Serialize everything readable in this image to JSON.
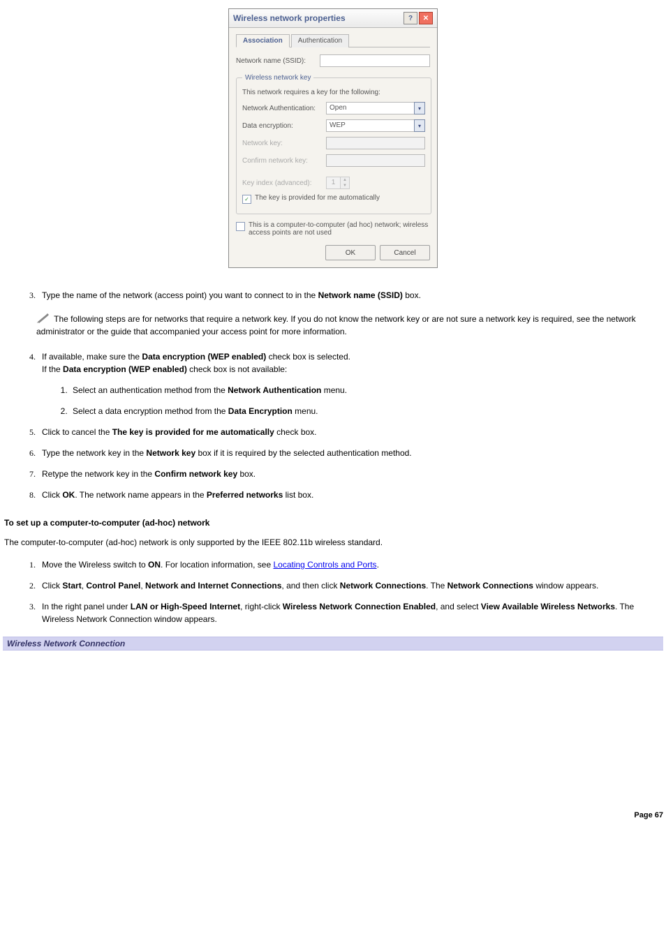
{
  "dialog": {
    "title": "Wireless network properties",
    "tabs": [
      "Association",
      "Authentication"
    ],
    "ssid_label": "Network name (SSID):",
    "group_legend": "Wireless network key",
    "group_note": "This network requires a key for the following:",
    "auth_label": "Network Authentication:",
    "auth_value": "Open",
    "enc_label": "Data encryption:",
    "enc_value": "WEP",
    "key_label": "Network key:",
    "confirm_label": "Confirm network key:",
    "keyindex_label": "Key index (advanced):",
    "keyindex_value": "1",
    "autokey_label": "The key is provided for me automatically",
    "adhoc_label": "This is a computer-to-computer (ad hoc) network; wireless access points are not used",
    "ok": "OK",
    "cancel": "Cancel"
  },
  "steps": {
    "s3_a": "Type the name of the network (access point) you want to connect to in the ",
    "s3_bold": "Network name (SSID)",
    "s3_b": " box.",
    "note": "The following steps are for networks that require a network key. If you do not know the network key or are not sure a network key is required, see the network administrator or the guide that accompanied your access point for more information.",
    "s4_a": "If available, make sure the ",
    "s4_bold1": "Data encryption (WEP enabled)",
    "s4_b": " check box is selected.",
    "s4_line2a": "If the ",
    "s4_line2bold": "Data encryption (WEP enabled)",
    "s4_line2b": " check box is not available:",
    "s4_1_a": "Select an authentication method from the ",
    "s4_1_bold": "Network Authentication",
    "s4_1_b": " menu.",
    "s4_2_a": "Select a data encryption method from the ",
    "s4_2_bold": "Data Encryption",
    "s4_2_b": " menu.",
    "s5_a": "Click to cancel the ",
    "s5_bold": "The key is provided for me automatically",
    "s5_b": " check box.",
    "s6_a": "Type the network key in the ",
    "s6_bold": "Network key",
    "s6_b": " box if it is required by the selected authentication method.",
    "s7_a": "Retype the network key in the ",
    "s7_bold": "Confirm network key",
    "s7_b": " box.",
    "s8_a": "Click ",
    "s8_bold1": "OK",
    "s8_b": ". The network name appears in the ",
    "s8_bold2": "Preferred networks",
    "s8_c": " list box."
  },
  "adhoc": {
    "heading": "To set up a computer-to-computer (ad-hoc) network",
    "intro": "The computer-to-computer (ad-hoc) network is only supported by the IEEE 802.11b wireless standard.",
    "s1_a": "Move the Wireless switch to ",
    "s1_bold": "ON",
    "s1_b": ". For location information, see ",
    "s1_link": "Locating Controls and Ports",
    "s1_c": ".",
    "s2_a": "Click ",
    "s2_b1": "Start",
    "s2_comma1": ", ",
    "s2_b2": "Control Panel",
    "s2_comma2": ", ",
    "s2_b3": "Network and Internet Connections",
    "s2_mid": ", and then click ",
    "s2_b4": "Network Connections",
    "s2_after": ". The ",
    "s2_b5": "Network Connections",
    "s2_end": " window appears.",
    "s3_a": "In the right panel under ",
    "s3_b1": "LAN or High-Speed Internet",
    "s3_mid1": ", right-click ",
    "s3_b2": "Wireless Network Connection Enabled",
    "s3_mid2": ", and select ",
    "s3_b3": "View Available Wireless Networks",
    "s3_end": ". The Wireless Network Connection window appears."
  },
  "caption": "Wireless Network Connection",
  "pagenum": "Page 67"
}
